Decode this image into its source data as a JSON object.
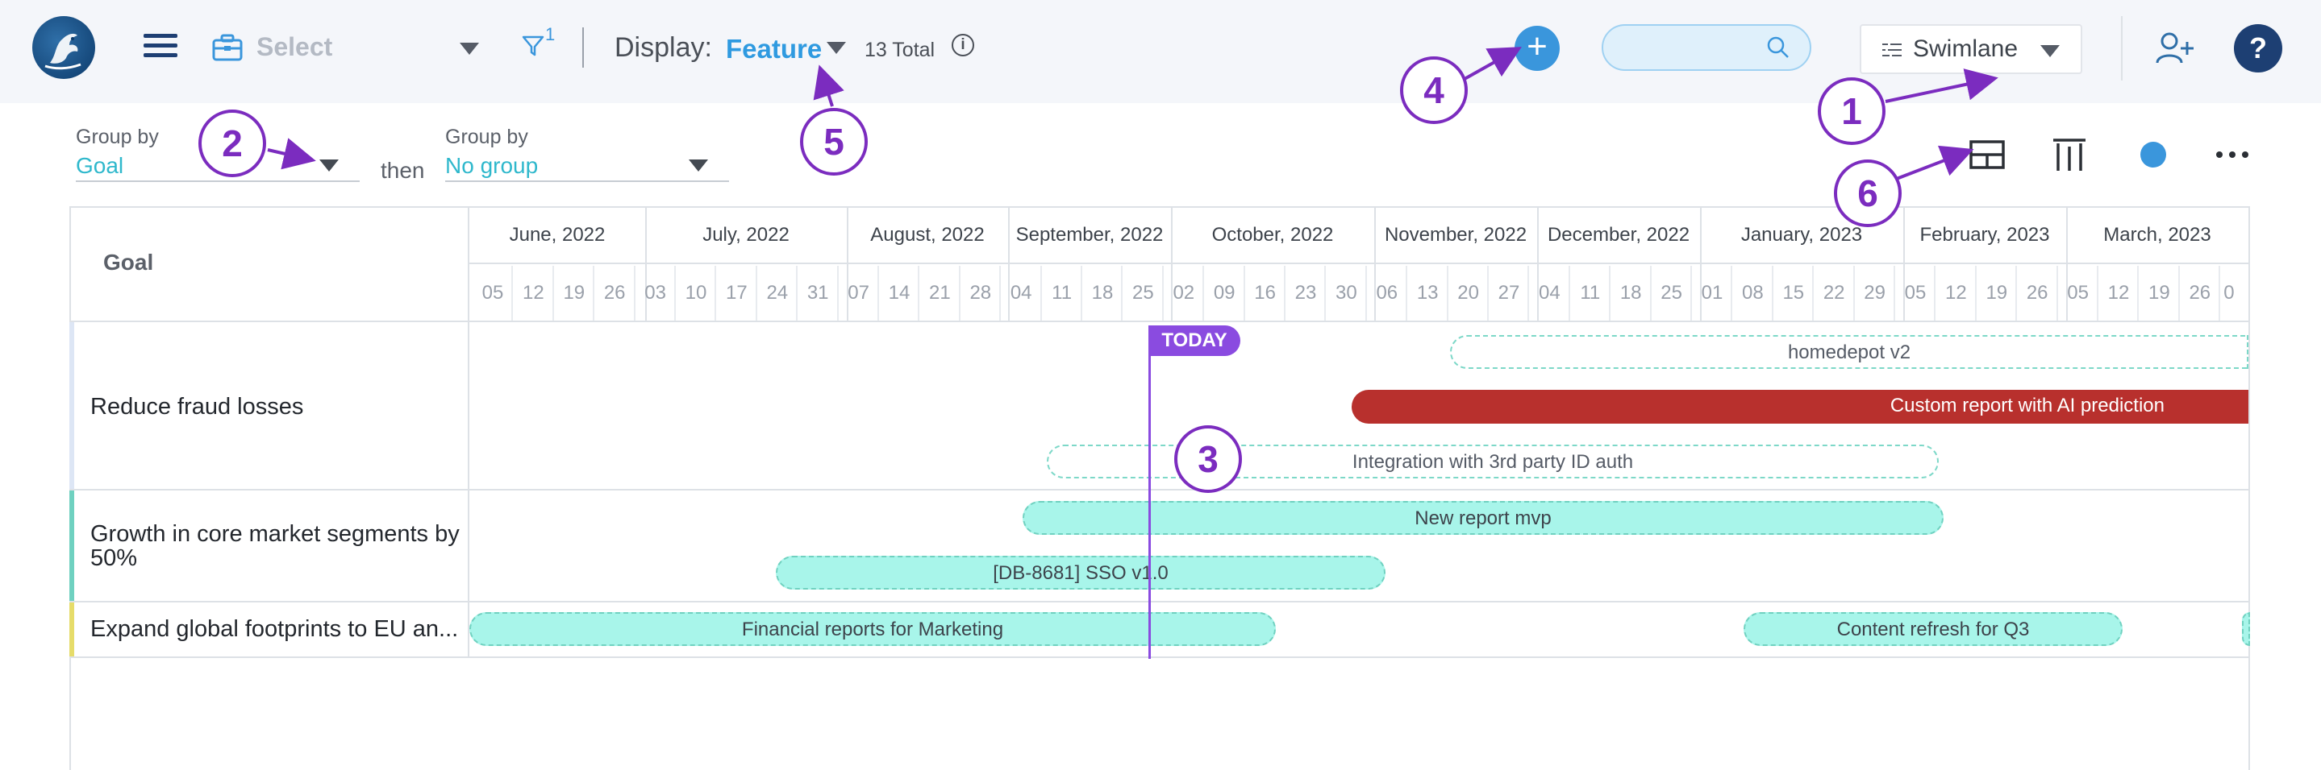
{
  "header": {
    "select_placeholder": "Select",
    "filter_count": "1",
    "display_label": "Display:",
    "display_value": "Feature",
    "total_text": "13 Total",
    "info_glyph": "i",
    "add_glyph": "+",
    "search_placeholder": "",
    "swimlane_label": "Swimlane",
    "help_glyph": "?"
  },
  "grouping": {
    "group1_caption": "Group by",
    "group1_value": "Goal",
    "then_label": "then",
    "group2_caption": "Group by",
    "group2_value": "No group"
  },
  "timeline": {
    "goal_header": "Goal",
    "months": [
      "June, 2022",
      "July, 2022",
      "August, 2022",
      "September, 2022",
      "October, 2022",
      "November, 2022",
      "December, 2022",
      "January, 2023",
      "February, 2023",
      "March, 2023"
    ],
    "weeks": [
      "05",
      "12",
      "19",
      "26",
      "03",
      "10",
      "17",
      "24",
      "31",
      "07",
      "14",
      "21",
      "28",
      "04",
      "11",
      "18",
      "25",
      "02",
      "09",
      "16",
      "23",
      "30",
      "06",
      "13",
      "20",
      "27",
      "04",
      "11",
      "18",
      "25",
      "01",
      "08",
      "15",
      "22",
      "29",
      "05",
      "12",
      "19",
      "26",
      "05",
      "12",
      "19",
      "26",
      "0"
    ],
    "today_label": "TODAY"
  },
  "rows": [
    {
      "label": "Reduce fraud losses",
      "accent": "#dde6f5",
      "bars": [
        {
          "label": "homedepot v2",
          "style": "dashed"
        },
        {
          "label": "Custom report with AI prediction",
          "style": "red"
        },
        {
          "label": "Integration with 3rd party ID auth",
          "style": "dashed"
        }
      ]
    },
    {
      "label": "Growth in core market segments by 50%",
      "accent": "#6fd1c0",
      "bars": [
        {
          "label": "New report mvp",
          "style": "teal"
        },
        {
          "label": "[DB-8681] SSO v1.0",
          "style": "teal"
        }
      ]
    },
    {
      "label": "Expand global footprints to EU an...",
      "accent": "#e6dc6a",
      "bars": [
        {
          "label": "Financial reports for Marketing",
          "style": "teal"
        },
        {
          "label": "Content refresh for Q3",
          "style": "teal"
        },
        {
          "label": "",
          "style": "teal"
        }
      ]
    }
  ],
  "callouts": [
    "1",
    "2",
    "3",
    "4",
    "5",
    "6"
  ],
  "colors": {
    "accent_blue": "#2f9ae0",
    "navy": "#1d3f73",
    "today_purple": "#8a4be0",
    "callout_purple": "#7b2cbf",
    "red_bar": "#b8302d",
    "teal_bar": "#a8f5ea"
  },
  "icons": [
    "logo-icon",
    "menu-icon",
    "briefcase-icon",
    "filter-icon",
    "info-icon",
    "plus-icon",
    "search-icon",
    "swimlane-icon",
    "add-user-icon",
    "help-icon",
    "layout-icon",
    "columns-icon",
    "color-dot-icon",
    "more-icon"
  ]
}
